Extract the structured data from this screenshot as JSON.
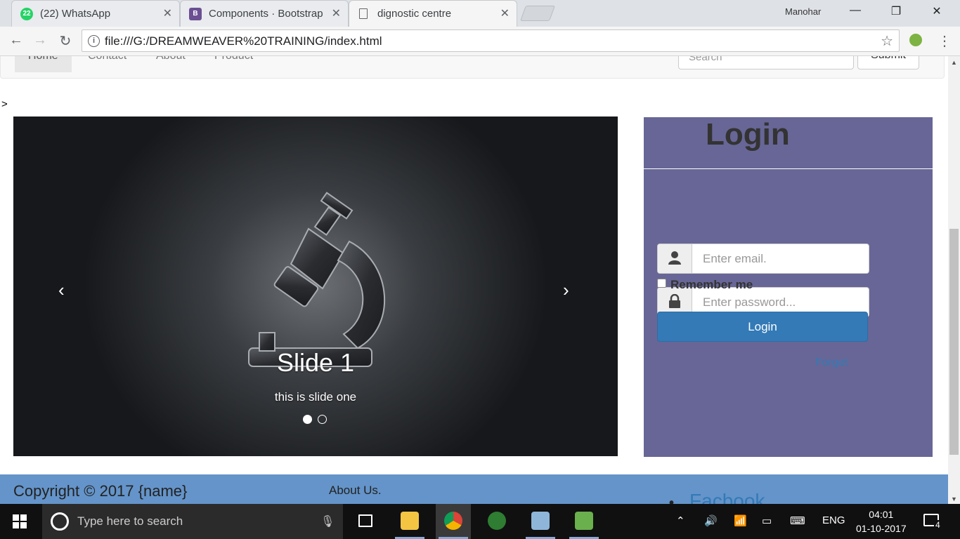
{
  "browser": {
    "profile_name": "Manohar",
    "tabs": [
      {
        "title": "(22) WhatsApp",
        "badge": "22",
        "icon": "whatsapp-icon"
      },
      {
        "title": "Components · Bootstrap",
        "badge": "B",
        "icon": "bootstrap-icon"
      },
      {
        "title": "dignostic centre",
        "icon": "page-icon"
      }
    ],
    "address": "file:///G:/DREAMWEAVER%20TRAINING/index.html"
  },
  "navbar": {
    "links": [
      "Home",
      "Contact",
      "About",
      "Product"
    ],
    "search_placeholder": "Search",
    "submit_label": "Submit"
  },
  "stray_text": ">",
  "carousel": {
    "slide_title": "Slide 1",
    "slide_caption": "this is slide one",
    "prev_label": "‹",
    "next_label": "›",
    "indicator_count": 2,
    "active_indicator": 1
  },
  "login": {
    "heading": "Login",
    "email_placeholder": "Enter email.",
    "password_placeholder": "Enter password...",
    "remember_label": "Remember me",
    "button_label": "Login",
    "forget_link": "Forget",
    "panel_color": "#676696",
    "button_color": "#337ab7"
  },
  "footer": {
    "copyright": "Copyright © 2017 {name}",
    "about_link": "About Us.",
    "social_link": "Facbook",
    "bg_color": "#6494c9"
  },
  "taskbar": {
    "search_placeholder": "Type here to search",
    "language": "ENG",
    "time": "04:01",
    "date": "01-10-2017",
    "notification_count": "4"
  }
}
